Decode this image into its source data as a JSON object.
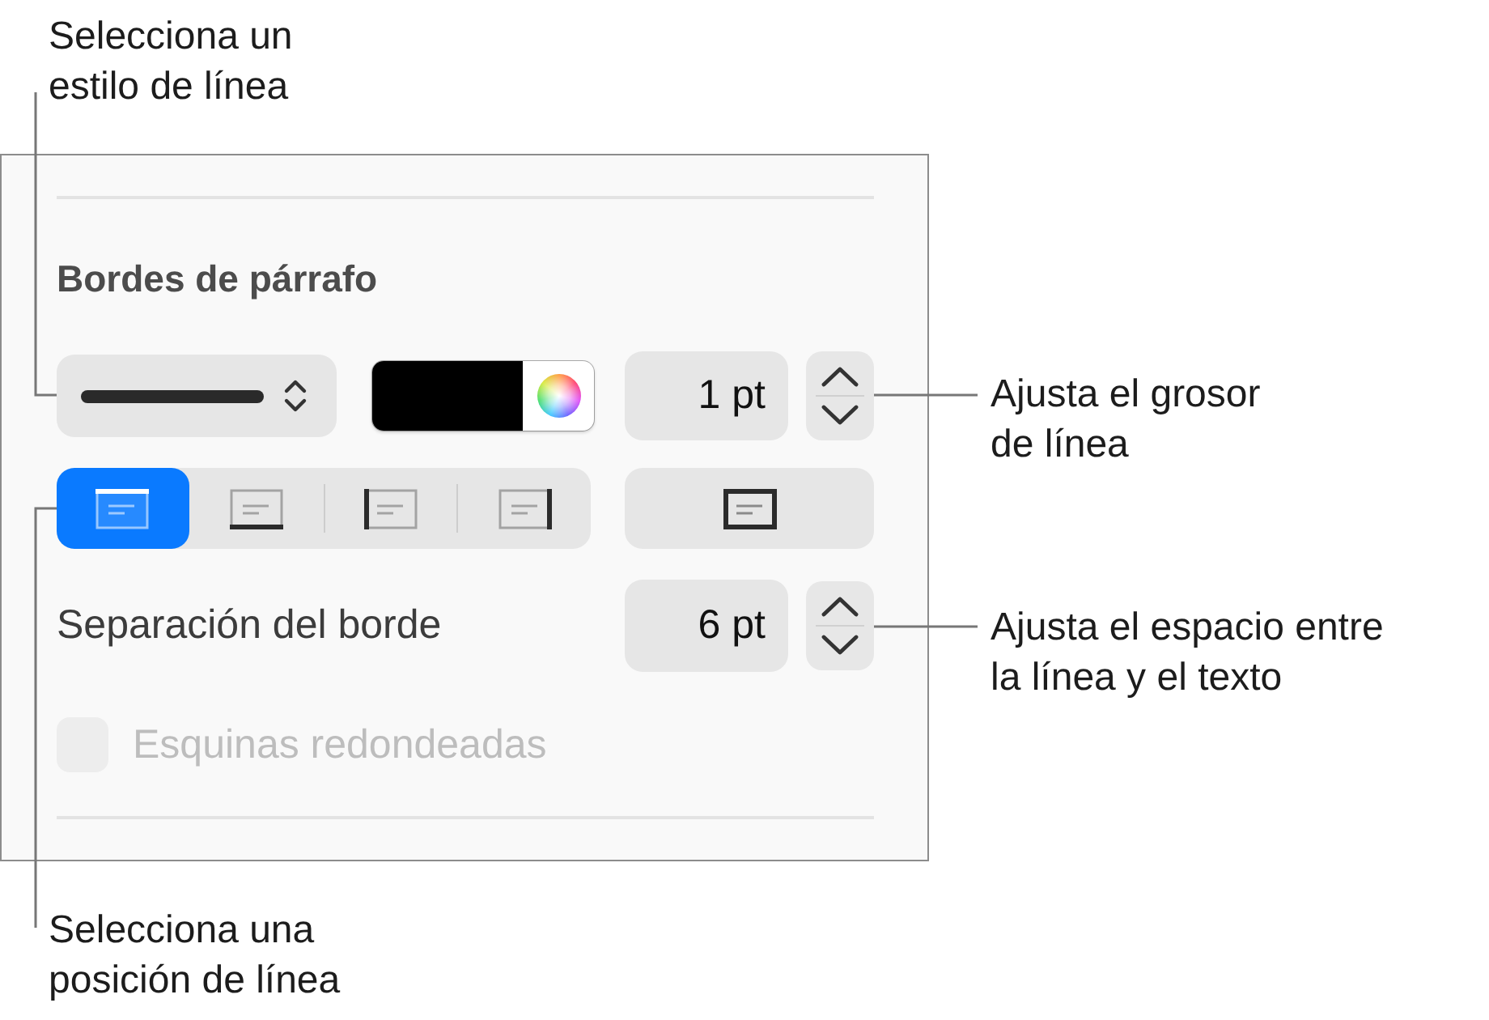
{
  "panel": {
    "title": "Bordes de párrafo",
    "line_style": {
      "kind": "solid"
    },
    "border_color": {
      "color": "#000000"
    },
    "line_width": {
      "value": "1 pt"
    },
    "positions": [
      {
        "kind": "top",
        "selected": true
      },
      {
        "kind": "bottom",
        "selected": false
      },
      {
        "kind": "left",
        "selected": false
      },
      {
        "kind": "right",
        "selected": false
      }
    ],
    "all_sides": {
      "selected": false
    },
    "spacing": {
      "label": "Separación del borde",
      "value": "6 pt"
    },
    "rounded_corners": {
      "label": "Esquinas redondeadas",
      "checked": false,
      "disabled": true
    }
  },
  "callouts": [
    {
      "lines": [
        "Selecciona un",
        "estilo de línea"
      ]
    },
    {
      "lines": [
        "Ajusta el grosor",
        "de línea"
      ]
    },
    {
      "lines": [
        "Ajusta el espacio entre",
        "la línea y el texto"
      ]
    },
    {
      "lines": [
        "Selecciona una",
        "posición de línea"
      ]
    }
  ]
}
